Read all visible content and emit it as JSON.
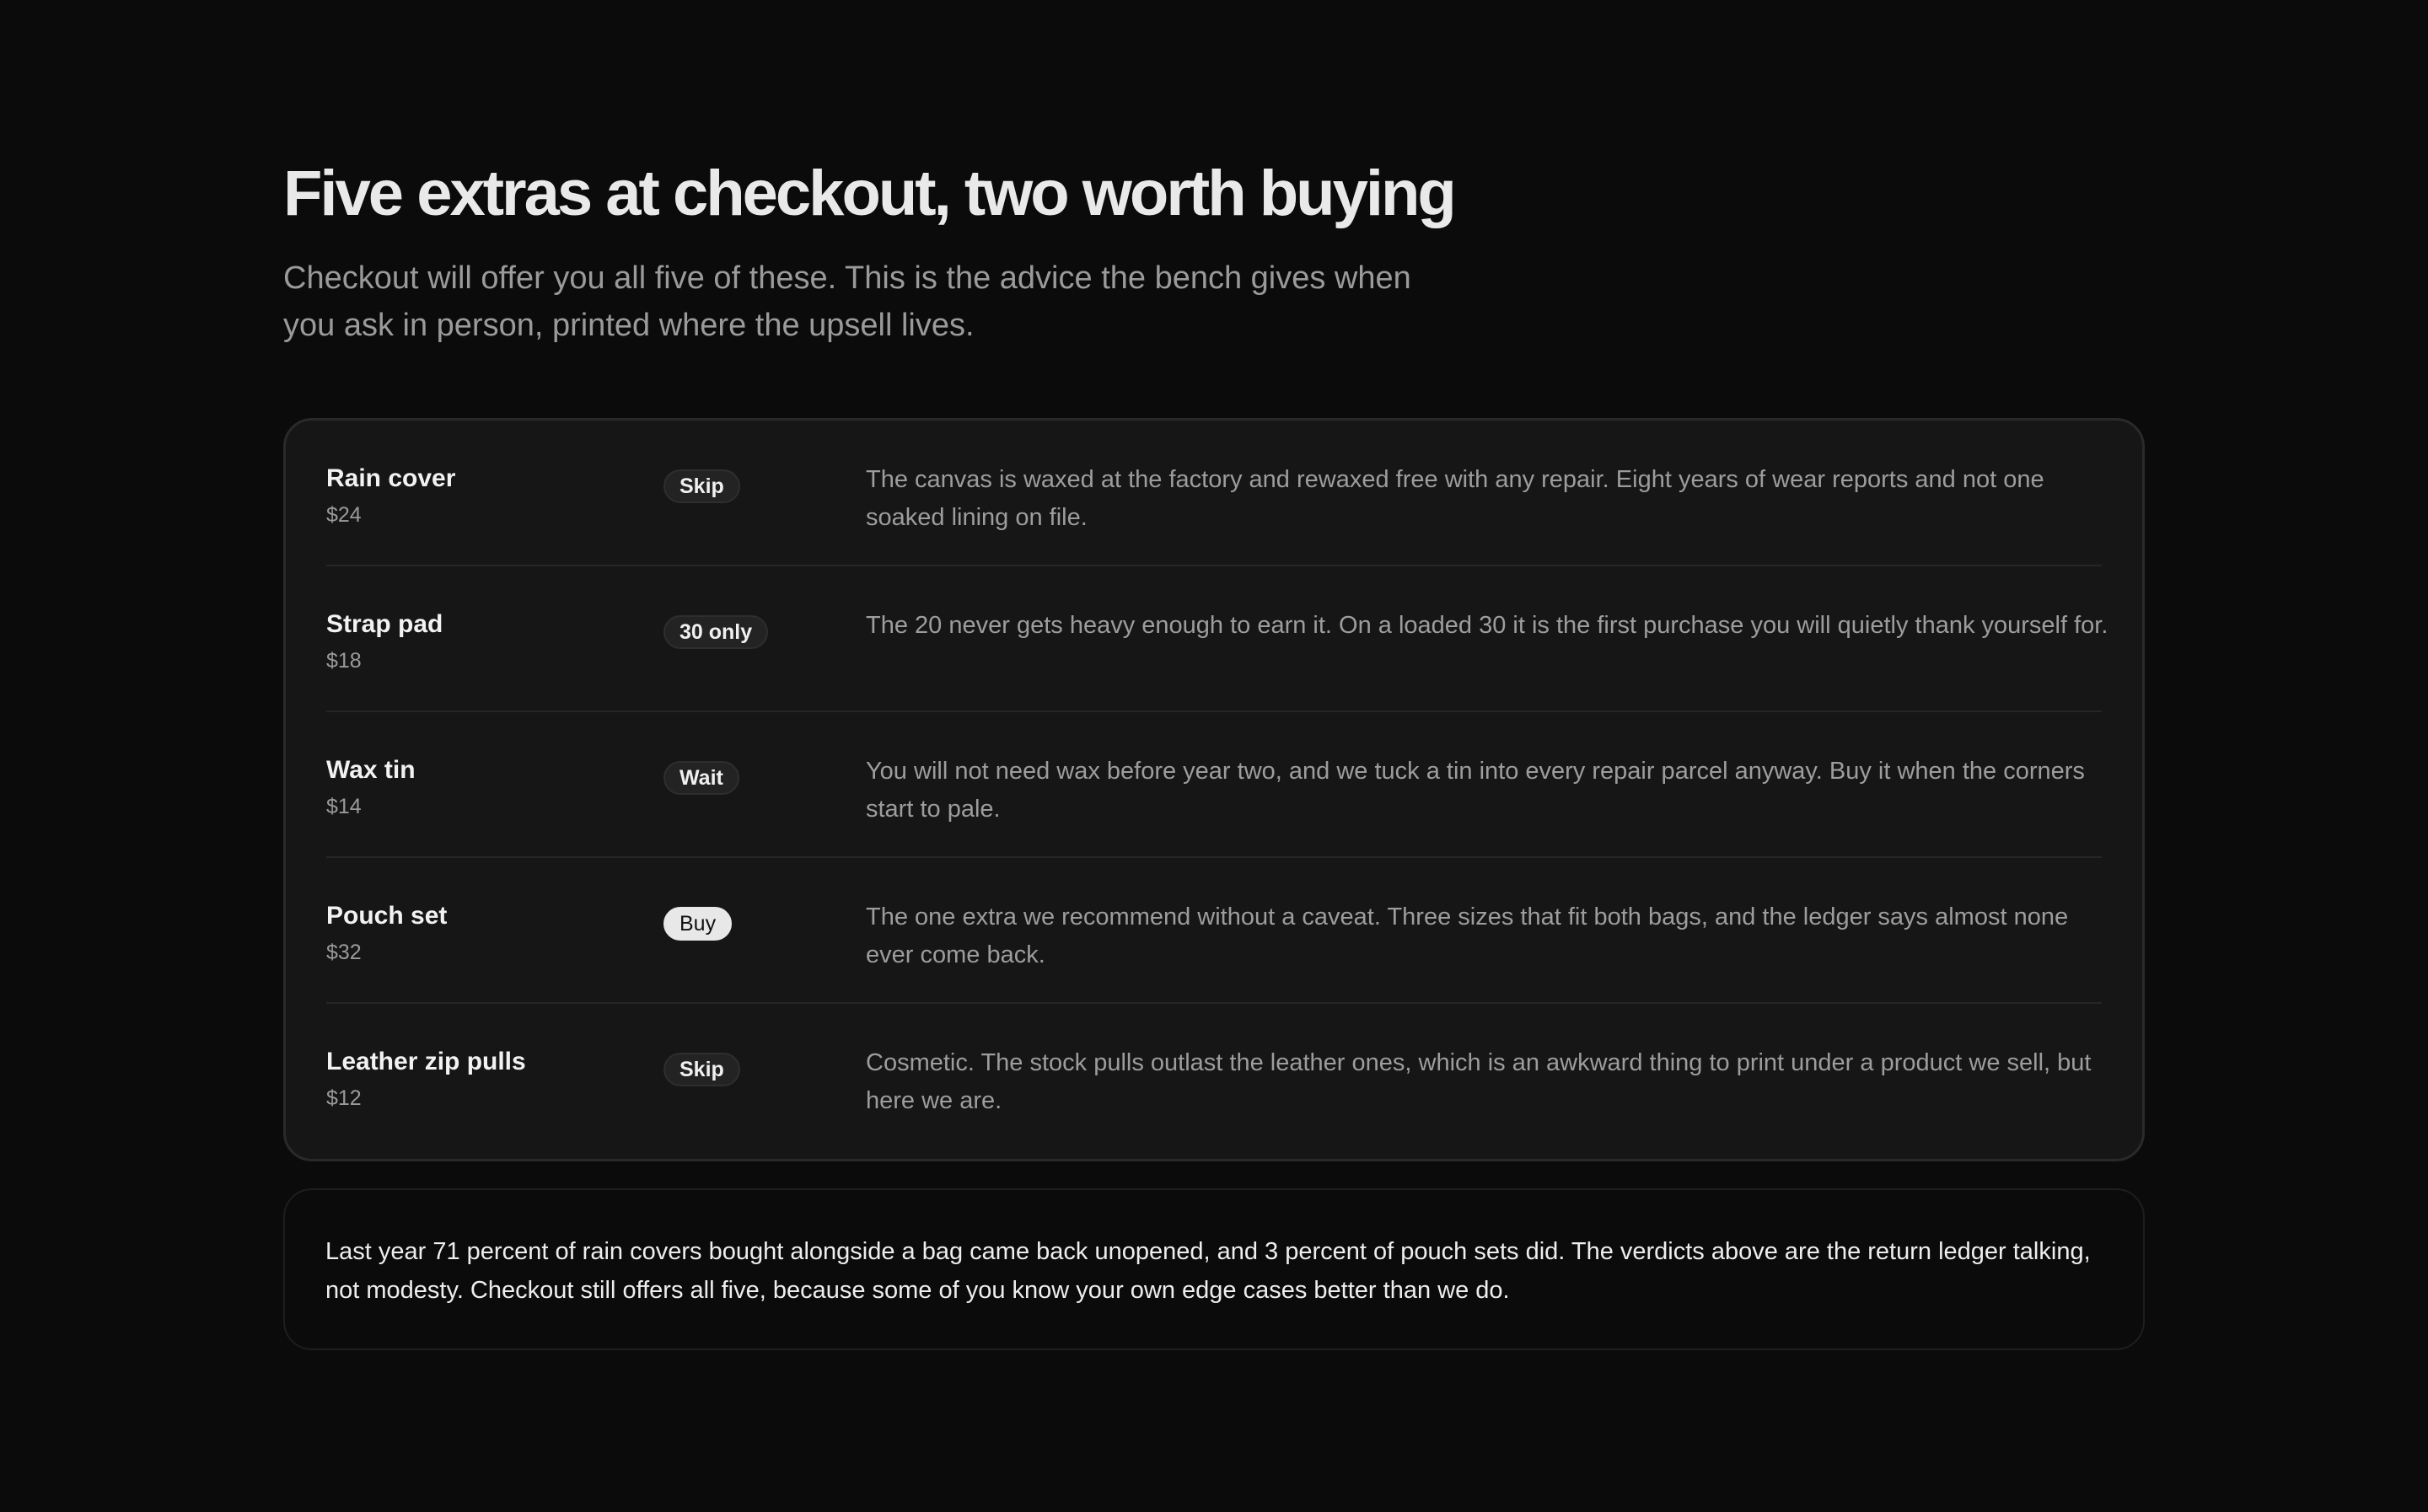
{
  "header": {
    "title": "Five extras at checkout, two worth buying",
    "subtitle": "Checkout will offer you all five of these. This is the advice the bench gives when you ask in person, printed where the upsell lives."
  },
  "extras": [
    {
      "name": "Rain cover",
      "price": "$24",
      "verdict": "Skip",
      "note": "The canvas is waxed at the factory and rewaxed free with any repair. Eight years of wear reports and not one soaked lining on file."
    },
    {
      "name": "Strap pad",
      "price": "$18",
      "verdict": "30 only",
      "note": "The 20 never gets heavy enough to earn it. On a loaded 30 it is the first purchase you will quietly thank yourself for."
    },
    {
      "name": "Wax tin",
      "price": "$14",
      "verdict": "Wait",
      "note": "You will not need wax before year two, and we tuck a tin into every repair parcel anyway. Buy it when the corners start to pale."
    },
    {
      "name": "Pouch set",
      "price": "$32",
      "verdict": "Buy",
      "note": "The one extra we recommend without a caveat. Three sizes that fit both bags, and the ledger says almost none ever come back."
    },
    {
      "name": "Leather zip pulls",
      "price": "$12",
      "verdict": "Skip",
      "note": "Cosmetic. The stock pulls outlast the leather ones, which is an awkward thing to print under a product we sell, but here we are."
    }
  ],
  "footer": {
    "text": "Last year 71 percent of rain covers bought alongside a bag came back unopened, and 3 percent of pouch sets did. The verdicts above are the return ledger talking, not modesty. Checkout still offers all five, because some of you know your own edge cases better than we do."
  }
}
